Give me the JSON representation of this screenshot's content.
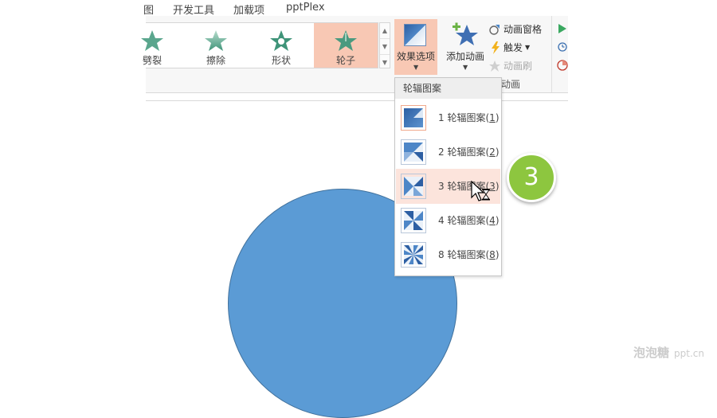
{
  "menu": {
    "tabs": [
      "图",
      "开发工具",
      "加载项",
      "pptPlex"
    ]
  },
  "gallery": {
    "items": [
      {
        "label": "劈裂"
      },
      {
        "label": "擦除"
      },
      {
        "label": "形状"
      },
      {
        "label": "轮子",
        "selected": true
      }
    ]
  },
  "ribbon": {
    "effects_options_label": "效果选项",
    "add_animation_label": "添加动画",
    "animation_pane_label": "动画窗格",
    "trigger_label": "触发",
    "animation_painter_label": "动画刷",
    "group_label": "动画"
  },
  "dropdown": {
    "header": "轮辐图案",
    "items": [
      {
        "num": "1",
        "label": "轮辐图案",
        "key": "1"
      },
      {
        "num": "2",
        "label": "轮辐图案",
        "key": "2"
      },
      {
        "num": "3",
        "label": "轮辐图案",
        "key": "3"
      },
      {
        "num": "4",
        "label": "轮辐图案",
        "key": "4"
      },
      {
        "num": "8",
        "label": "轮辐图案",
        "key": "8"
      }
    ]
  },
  "annotation": {
    "step_number": "3"
  },
  "watermark": {
    "text": "泡泡糖",
    "domain": "ppt.cn"
  },
  "colors": {
    "accent_selected": "#f8c8b4",
    "shape_fill": "#5b9bd5",
    "badge_green": "#8dc63f"
  }
}
